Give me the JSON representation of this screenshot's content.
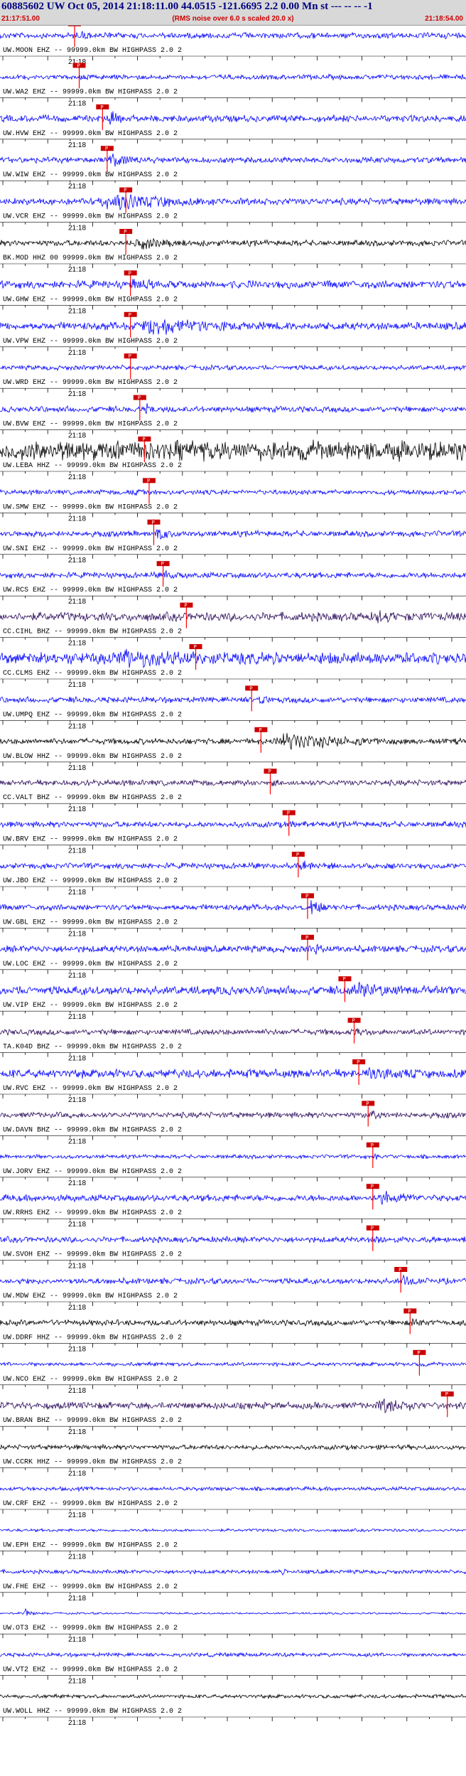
{
  "header": {
    "title": "60885602 UW Oct 05, 2014 21:18:11.00   44.0515 -121.6695  2.2 0.00 Mn st --- -- --  -1",
    "start_time": "21:17:51.00",
    "noise_note": "(RMS noise over 6.0 s scaled 20.0 x)",
    "end_time": "21:18:54.00"
  },
  "colors": {
    "blue": "#0000ff",
    "black": "#000000",
    "purple": "#2a0a5a",
    "pick": "#ff0000",
    "pick_label_bg": "#cc0000"
  },
  "tick_time_label": "21:18",
  "traces": [
    {
      "label": "UW.MOON EHZ -- 99999.0km BW  HIGHPASS  2.0  2",
      "color": "blue",
      "pick": 0.16,
      "pick_label": "P",
      "amp": 0.3,
      "burst": [
        0.17,
        0.25,
        0.55
      ]
    },
    {
      "label": "UW.WA2 EHZ -- 99999.0km BW  HIGHPASS  2.0  2",
      "color": "blue",
      "pick": 0.17,
      "pick_label": "P",
      "amp": 0.25,
      "burst": [
        0.17,
        0.22,
        0.5
      ]
    },
    {
      "label": "UW.HVW EHZ -- 99999.0km BW  HIGHPASS  2.0  2",
      "color": "blue",
      "pick": 0.22,
      "pick_label": "P",
      "amp": 0.35,
      "burst": [
        0.23,
        0.3,
        0.8
      ]
    },
    {
      "label": "UW.WIW EHZ -- 99999.0km BW  HIGHPASS  2.0  2",
      "color": "blue",
      "pick": 0.23,
      "pick_label": "P",
      "amp": 0.3,
      "burst": [
        0.23,
        0.33,
        1.0
      ]
    },
    {
      "label": "UW.VCR EHZ -- 99999.0km BW  HIGHPASS  2.0  2",
      "color": "blue",
      "pick": 0.27,
      "pick_label": "P",
      "amp": 0.35,
      "burst": [
        0.19,
        0.62,
        1.0
      ]
    },
    {
      "label": "BK.MOD HHZ 00 99999.0km BW  HIGHPASS  2.0  2",
      "color": "black",
      "pick": 0.27,
      "pick_label": "P",
      "amp": 0.3,
      "burst": [
        0.28,
        0.5,
        0.7
      ]
    },
    {
      "label": "UW.GHW EHZ -- 99999.0km BW  HIGHPASS  2.0  2",
      "color": "blue",
      "pick": 0.28,
      "pick_label": "P",
      "amp": 0.4,
      "burst": [
        0.26,
        0.55,
        0.6
      ]
    },
    {
      "label": "UW.VPW EHZ -- 99999.0km BW  HIGHPASS  2.0  2",
      "color": "blue",
      "pick": 0.28,
      "pick_label": "P",
      "amp": 0.4,
      "burst": [
        0.28,
        0.72,
        1.0
      ]
    },
    {
      "label": "UW.WRD EHZ -- 99999.0km BW  HIGHPASS  2.0  2",
      "color": "blue",
      "pick": 0.28,
      "pick_label": "P",
      "amp": 0.25,
      "burst": [
        0.29,
        0.35,
        0.4
      ]
    },
    {
      "label": "UW.BVW EHZ -- 99999.0km BW  HIGHPASS  2.0  2",
      "color": "blue",
      "pick": 0.3,
      "pick_label": "P",
      "amp": 0.3,
      "burst": [
        0.31,
        0.36,
        0.7
      ]
    },
    {
      "label": "UW.LEBA HHZ -- 99999.0km BW  HIGHPASS  2.0  2",
      "color": "black",
      "pick": 0.31,
      "pick_label": "P",
      "amp": 1.0,
      "burst": [
        0.0,
        1.0,
        1.0
      ]
    },
    {
      "label": "UW.SMW EHZ -- 99999.0km BW  HIGHPASS  2.0  2",
      "color": "blue",
      "pick": 0.32,
      "pick_label": "P",
      "amp": 0.25,
      "burst": [
        0.28,
        0.34,
        0.5
      ]
    },
    {
      "label": "UW.SNI EHZ -- 99999.0km BW  HIGHPASS  2.0  2",
      "color": "blue",
      "pick": 0.33,
      "pick_label": "P",
      "amp": 0.3,
      "burst": [
        0.33,
        0.4,
        0.9
      ]
    },
    {
      "label": "UW.RCS EHZ -- 99999.0km BW  HIGHPASS  2.0  2",
      "color": "blue",
      "pick": 0.35,
      "pick_label": "P",
      "amp": 0.3,
      "burst": [
        0.35,
        0.4,
        0.8
      ]
    },
    {
      "label": "CC.CIHL BHZ -- 99999.0km BW  HIGHPASS  2.0  2",
      "color": "purple",
      "pick": 0.4,
      "pick_label": "P",
      "amp": 0.45,
      "burst": [
        0.8,
        0.92,
        0.9
      ]
    },
    {
      "label": "CC.CLMS EHZ -- 99999.0km BW  HIGHPASS  2.0  2",
      "color": "blue",
      "pick": 0.42,
      "pick_label": "P",
      "amp": 0.6,
      "burst": [
        0.2,
        0.95,
        1.0
      ]
    },
    {
      "label": "UW.UMPQ EHZ -- 99999.0km BW  HIGHPASS  2.0  2",
      "color": "blue",
      "pick": 0.54,
      "pick_label": "P",
      "amp": 0.3,
      "burst": [
        0.55,
        0.6,
        0.8
      ]
    },
    {
      "label": "UW.BLOW HHZ -- 99999.0km BW  HIGHPASS  2.0  2",
      "color": "black",
      "pick": 0.56,
      "pick_label": "P",
      "amp": 0.3,
      "burst": [
        0.57,
        1.0,
        0.9
      ]
    },
    {
      "label": "CC.VALT BHZ -- 99999.0km BW  HIGHPASS  2.0  2",
      "color": "purple",
      "pick": 0.58,
      "pick_label": "P",
      "amp": 0.3,
      "burst": [
        0.58,
        0.64,
        0.5
      ]
    },
    {
      "label": "UW.BRV EHZ -- 99999.0km BW  HIGHPASS  2.0  2",
      "color": "blue",
      "pick": 0.62,
      "pick_label": "P",
      "amp": 0.3,
      "burst": [
        0.62,
        0.67,
        0.6
      ]
    },
    {
      "label": "UW.JBO EHZ -- 99999.0km BW  HIGHPASS  2.0  2",
      "color": "blue",
      "pick": 0.64,
      "pick_label": "P",
      "amp": 0.3,
      "burst": [
        0.64,
        0.7,
        0.7
      ]
    },
    {
      "label": "UW.GBL EHZ -- 99999.0km BW  HIGHPASS  2.0  2",
      "color": "blue",
      "pick": 0.66,
      "pick_label": "P",
      "amp": 0.3,
      "burst": [
        0.66,
        0.74,
        0.9
      ]
    },
    {
      "label": "UW.LOC EHZ -- 99999.0km BW  HIGHPASS  2.0  2",
      "color": "blue",
      "pick": 0.66,
      "pick_label": "P",
      "amp": 0.35,
      "burst": [
        0.67,
        0.75,
        0.7
      ]
    },
    {
      "label": "UW.VIP EHZ -- 99999.0km BW  HIGHPASS  2.0  2",
      "color": "blue",
      "pick": 0.74,
      "pick_label": "P",
      "amp": 0.45,
      "burst": [
        0.74,
        1.0,
        0.9
      ]
    },
    {
      "label": "TA.K04D BHZ -- 99999.0km BW  HIGHPASS  2.0  2",
      "color": "purple",
      "pick": 0.76,
      "pick_label": "P",
      "amp": 0.3,
      "burst": [
        0.76,
        0.82,
        0.6
      ]
    },
    {
      "label": "UW.RVC EHZ -- 99999.0km BW  HIGHPASS  2.0  2",
      "color": "blue",
      "pick": 0.77,
      "pick_label": "P",
      "amp": 0.45,
      "burst": [
        0.77,
        1.0,
        0.8
      ]
    },
    {
      "label": "UW.DAVN BHZ -- 99999.0km BW  HIGHPASS  2.0  2",
      "color": "purple",
      "pick": 0.79,
      "pick_label": "P",
      "amp": 0.3,
      "burst": [
        0.79,
        0.85,
        0.6
      ]
    },
    {
      "label": "UW.JORV EHZ -- 99999.0km BW  HIGHPASS  2.0  2",
      "color": "blue",
      "pick": 0.8,
      "pick_label": "P",
      "amp": 0.2,
      "burst": [
        0.8,
        0.85,
        0.4
      ]
    },
    {
      "label": "UW.RRHS EHZ -- 99999.0km BW  HIGHPASS  2.0  2",
      "color": "blue",
      "pick": 0.8,
      "pick_label": "P",
      "amp": 0.35,
      "burst": [
        0.8,
        1.0,
        0.8
      ]
    },
    {
      "label": "UW.SVOH EHZ -- 99999.0km BW  HIGHPASS  2.0  2",
      "color": "blue",
      "pick": 0.8,
      "pick_label": "P",
      "amp": 0.3,
      "burst": [
        0.8,
        0.88,
        0.5
      ]
    },
    {
      "label": "UW.MDW EHZ -- 99999.0km BW  HIGHPASS  2.0  2",
      "color": "blue",
      "pick": 0.86,
      "pick_label": "P",
      "amp": 0.3,
      "burst": [
        0.86,
        0.92,
        0.9
      ]
    },
    {
      "label": "UW.DDRF HHZ -- 99999.0km BW  HIGHPASS  2.0  2",
      "color": "black",
      "pick": 0.88,
      "pick_label": "P",
      "amp": 0.3,
      "burst": [
        0.88,
        0.93,
        0.8
      ]
    },
    {
      "label": "UW.NCO EHZ -- 99999.0km BW  HIGHPASS  2.0  2",
      "color": "blue",
      "pick": 0.9,
      "pick_label": "P",
      "amp": 0.2,
      "burst": [
        0.9,
        0.95,
        0.3
      ]
    },
    {
      "label": "UW.BRAN BHZ -- 99999.0km BW  HIGHPASS  2.0  2",
      "color": "purple",
      "pick": 0.96,
      "pick_label": "P",
      "amp": 0.35,
      "burst": [
        0.8,
        1.0,
        0.9
      ]
    },
    {
      "label": "UW.CCRK HHZ -- 99999.0km BW  HIGHPASS  2.0  2",
      "color": "black",
      "pick": null,
      "pick_label": "",
      "amp": 0.25,
      "burst": [
        0,
        0,
        0
      ]
    },
    {
      "label": "UW.CRF EHZ -- 99999.0km BW  HIGHPASS  2.0  2",
      "color": "blue",
      "pick": null,
      "pick_label": "",
      "amp": 0.2,
      "burst": [
        0,
        0,
        0
      ]
    },
    {
      "label": "UW.EPH EHZ -- 99999.0km BW  HIGHPASS  2.0  2",
      "color": "blue",
      "pick": null,
      "pick_label": "",
      "amp": 0.15,
      "burst": [
        0,
        0,
        0
      ]
    },
    {
      "label": "UW.FHE EHZ -- 99999.0km BW  HIGHPASS  2.0  2",
      "color": "blue",
      "pick": null,
      "pick_label": "",
      "amp": 0.2,
      "burst": [
        0.6,
        0.64,
        0.4
      ]
    },
    {
      "label": "UW.OT3 EHZ -- 99999.0km BW  HIGHPASS  2.0  2",
      "color": "blue",
      "pick": null,
      "pick_label": "",
      "amp": 0.1,
      "burst": [
        0.05,
        0.09,
        0.5
      ]
    },
    {
      "label": "UW.VT2 EHZ -- 99999.0km BW  HIGHPASS  2.0  2",
      "color": "blue",
      "pick": null,
      "pick_label": "",
      "amp": 0.2,
      "burst": [
        0,
        0,
        0
      ]
    },
    {
      "label": "UW.WOLL HHZ -- 99999.0km BW  HIGHPASS  2.0  2",
      "color": "black",
      "pick": null,
      "pick_label": "",
      "amp": 0.2,
      "burst": [
        0,
        0,
        0
      ]
    }
  ]
}
